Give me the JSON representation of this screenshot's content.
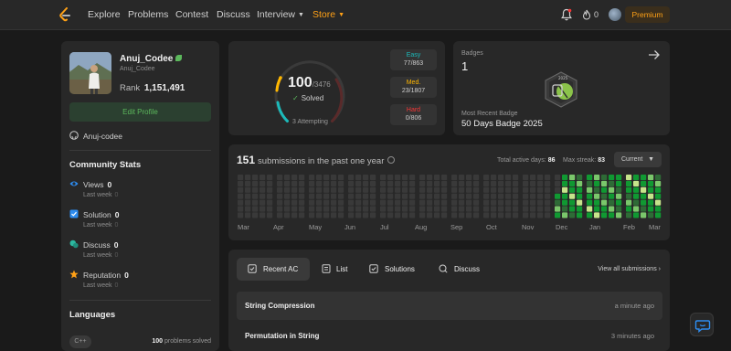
{
  "nav": {
    "items": [
      "Explore",
      "Problems",
      "Contest",
      "Discuss",
      "Interview",
      "Store"
    ],
    "fire_count": "0",
    "premium": "Premium"
  },
  "profile": {
    "name": "Anuj_Codee",
    "handle": "Anuj_Codee",
    "rank_label": "Rank",
    "rank": "1,151,491",
    "edit_label": "Edit Profile",
    "github": "Anuj-codee"
  },
  "community": {
    "title": "Community Stats",
    "last_week": "Last week",
    "items": [
      {
        "label": "Views",
        "value": "0",
        "delta": "0",
        "icon": "eye-icon",
        "color": "#2d8cf0"
      },
      {
        "label": "Solution",
        "value": "0",
        "delta": "0",
        "icon": "checkbox-icon",
        "color": "#2d8cf0"
      },
      {
        "label": "Discuss",
        "value": "0",
        "delta": "0",
        "icon": "chat-bubbles-icon",
        "color": "#2db8a0"
      },
      {
        "label": "Reputation",
        "value": "0",
        "delta": "0",
        "icon": "star-icon",
        "color": "#ffa116"
      }
    ]
  },
  "languages": {
    "title": "Languages",
    "items": [
      {
        "name": "C++",
        "count": "100",
        "suffix": "problems solved"
      }
    ]
  },
  "progress": {
    "solved": "100",
    "total": "/3476",
    "solved_label": "Solved",
    "attempting": "3 Attempting",
    "difficulty": [
      {
        "name": "Easy",
        "value": "77/863",
        "color": "#1cbaba"
      },
      {
        "name": "Med.",
        "value": "23/1807",
        "color": "#ffb700"
      },
      {
        "name": "Hard",
        "value": "0/806",
        "color": "#f63737"
      }
    ]
  },
  "badges": {
    "title": "Badges",
    "count": "1",
    "recent_label": "Most Recent Badge",
    "recent_name": "50 Days Badge 2025"
  },
  "heatmap": {
    "count": "151",
    "title": "submissions in the past one year",
    "active_days_label": "Total active days:",
    "active_days": "86",
    "max_streak_label": "Max streak:",
    "max_streak": "83",
    "range": "Current",
    "months": [
      "Mar",
      "Apr",
      "May",
      "Jun",
      "Jul",
      "Aug",
      "Sep",
      "Oct",
      "Nov",
      "Dec",
      "Jan",
      "Feb",
      "Mar"
    ]
  },
  "recent": {
    "tabs": [
      {
        "label": "Recent AC",
        "icon": "recent-ac-icon"
      },
      {
        "label": "List",
        "icon": "list-icon"
      },
      {
        "label": "Solutions",
        "icon": "solutions-icon"
      },
      {
        "label": "Discuss",
        "icon": "discuss-icon"
      }
    ],
    "view_all": "View all submissions",
    "items": [
      {
        "title": "String Compression",
        "time": "a minute ago"
      },
      {
        "title": "Permutation in String",
        "time": "3 minutes ago"
      }
    ]
  }
}
